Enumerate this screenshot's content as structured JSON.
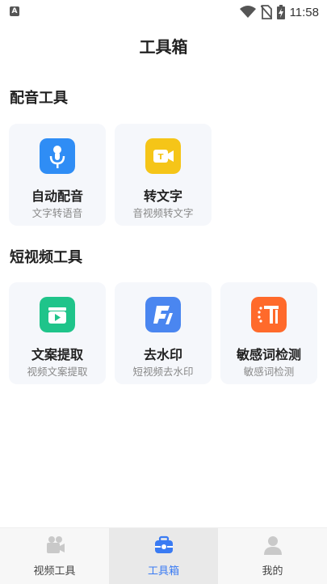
{
  "status_bar": {
    "time": "11:58",
    "app_badge": "A"
  },
  "page": {
    "title": "工具箱"
  },
  "sections": [
    {
      "title": "配音工具",
      "tools": [
        {
          "name": "自动配音",
          "desc": "文字转语音",
          "color": "#2f8df5",
          "icon": "microphone-icon"
        },
        {
          "name": "转文字",
          "desc": "音视频转文字",
          "color": "#f5c518",
          "icon": "video-to-text-icon"
        }
      ]
    },
    {
      "title": "短视频工具",
      "tools": [
        {
          "name": "文案提取",
          "desc": "视频文案提取",
          "color": "#1fc48a",
          "icon": "tv-play-icon"
        },
        {
          "name": "去水印",
          "desc": "短视频去水印",
          "color": "#4a86f0",
          "icon": "watermark-icon"
        },
        {
          "name": "敏感词检测",
          "desc": "敏感词检测",
          "color": "#ff6a2b",
          "icon": "sensitive-word-icon"
        }
      ]
    }
  ],
  "tabbar": {
    "items": [
      {
        "label": "视频工具",
        "icon": "film-camera-icon",
        "active": false
      },
      {
        "label": "工具箱",
        "icon": "toolbox-icon",
        "active": true
      },
      {
        "label": "我的",
        "icon": "person-icon",
        "active": false
      }
    ],
    "active_color": "#3a7bf3"
  }
}
